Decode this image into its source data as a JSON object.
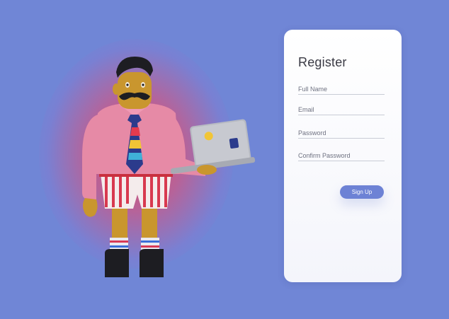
{
  "form": {
    "title": "Register",
    "fields": [
      {
        "placeholder": "Full Name"
      },
      {
        "placeholder": "Email"
      },
      {
        "placeholder": "Password"
      },
      {
        "placeholder": "Confirm Password"
      }
    ],
    "submit_label": "Sign Up"
  },
  "illustration": {
    "subject": "mustached-man-holding-laptop"
  }
}
